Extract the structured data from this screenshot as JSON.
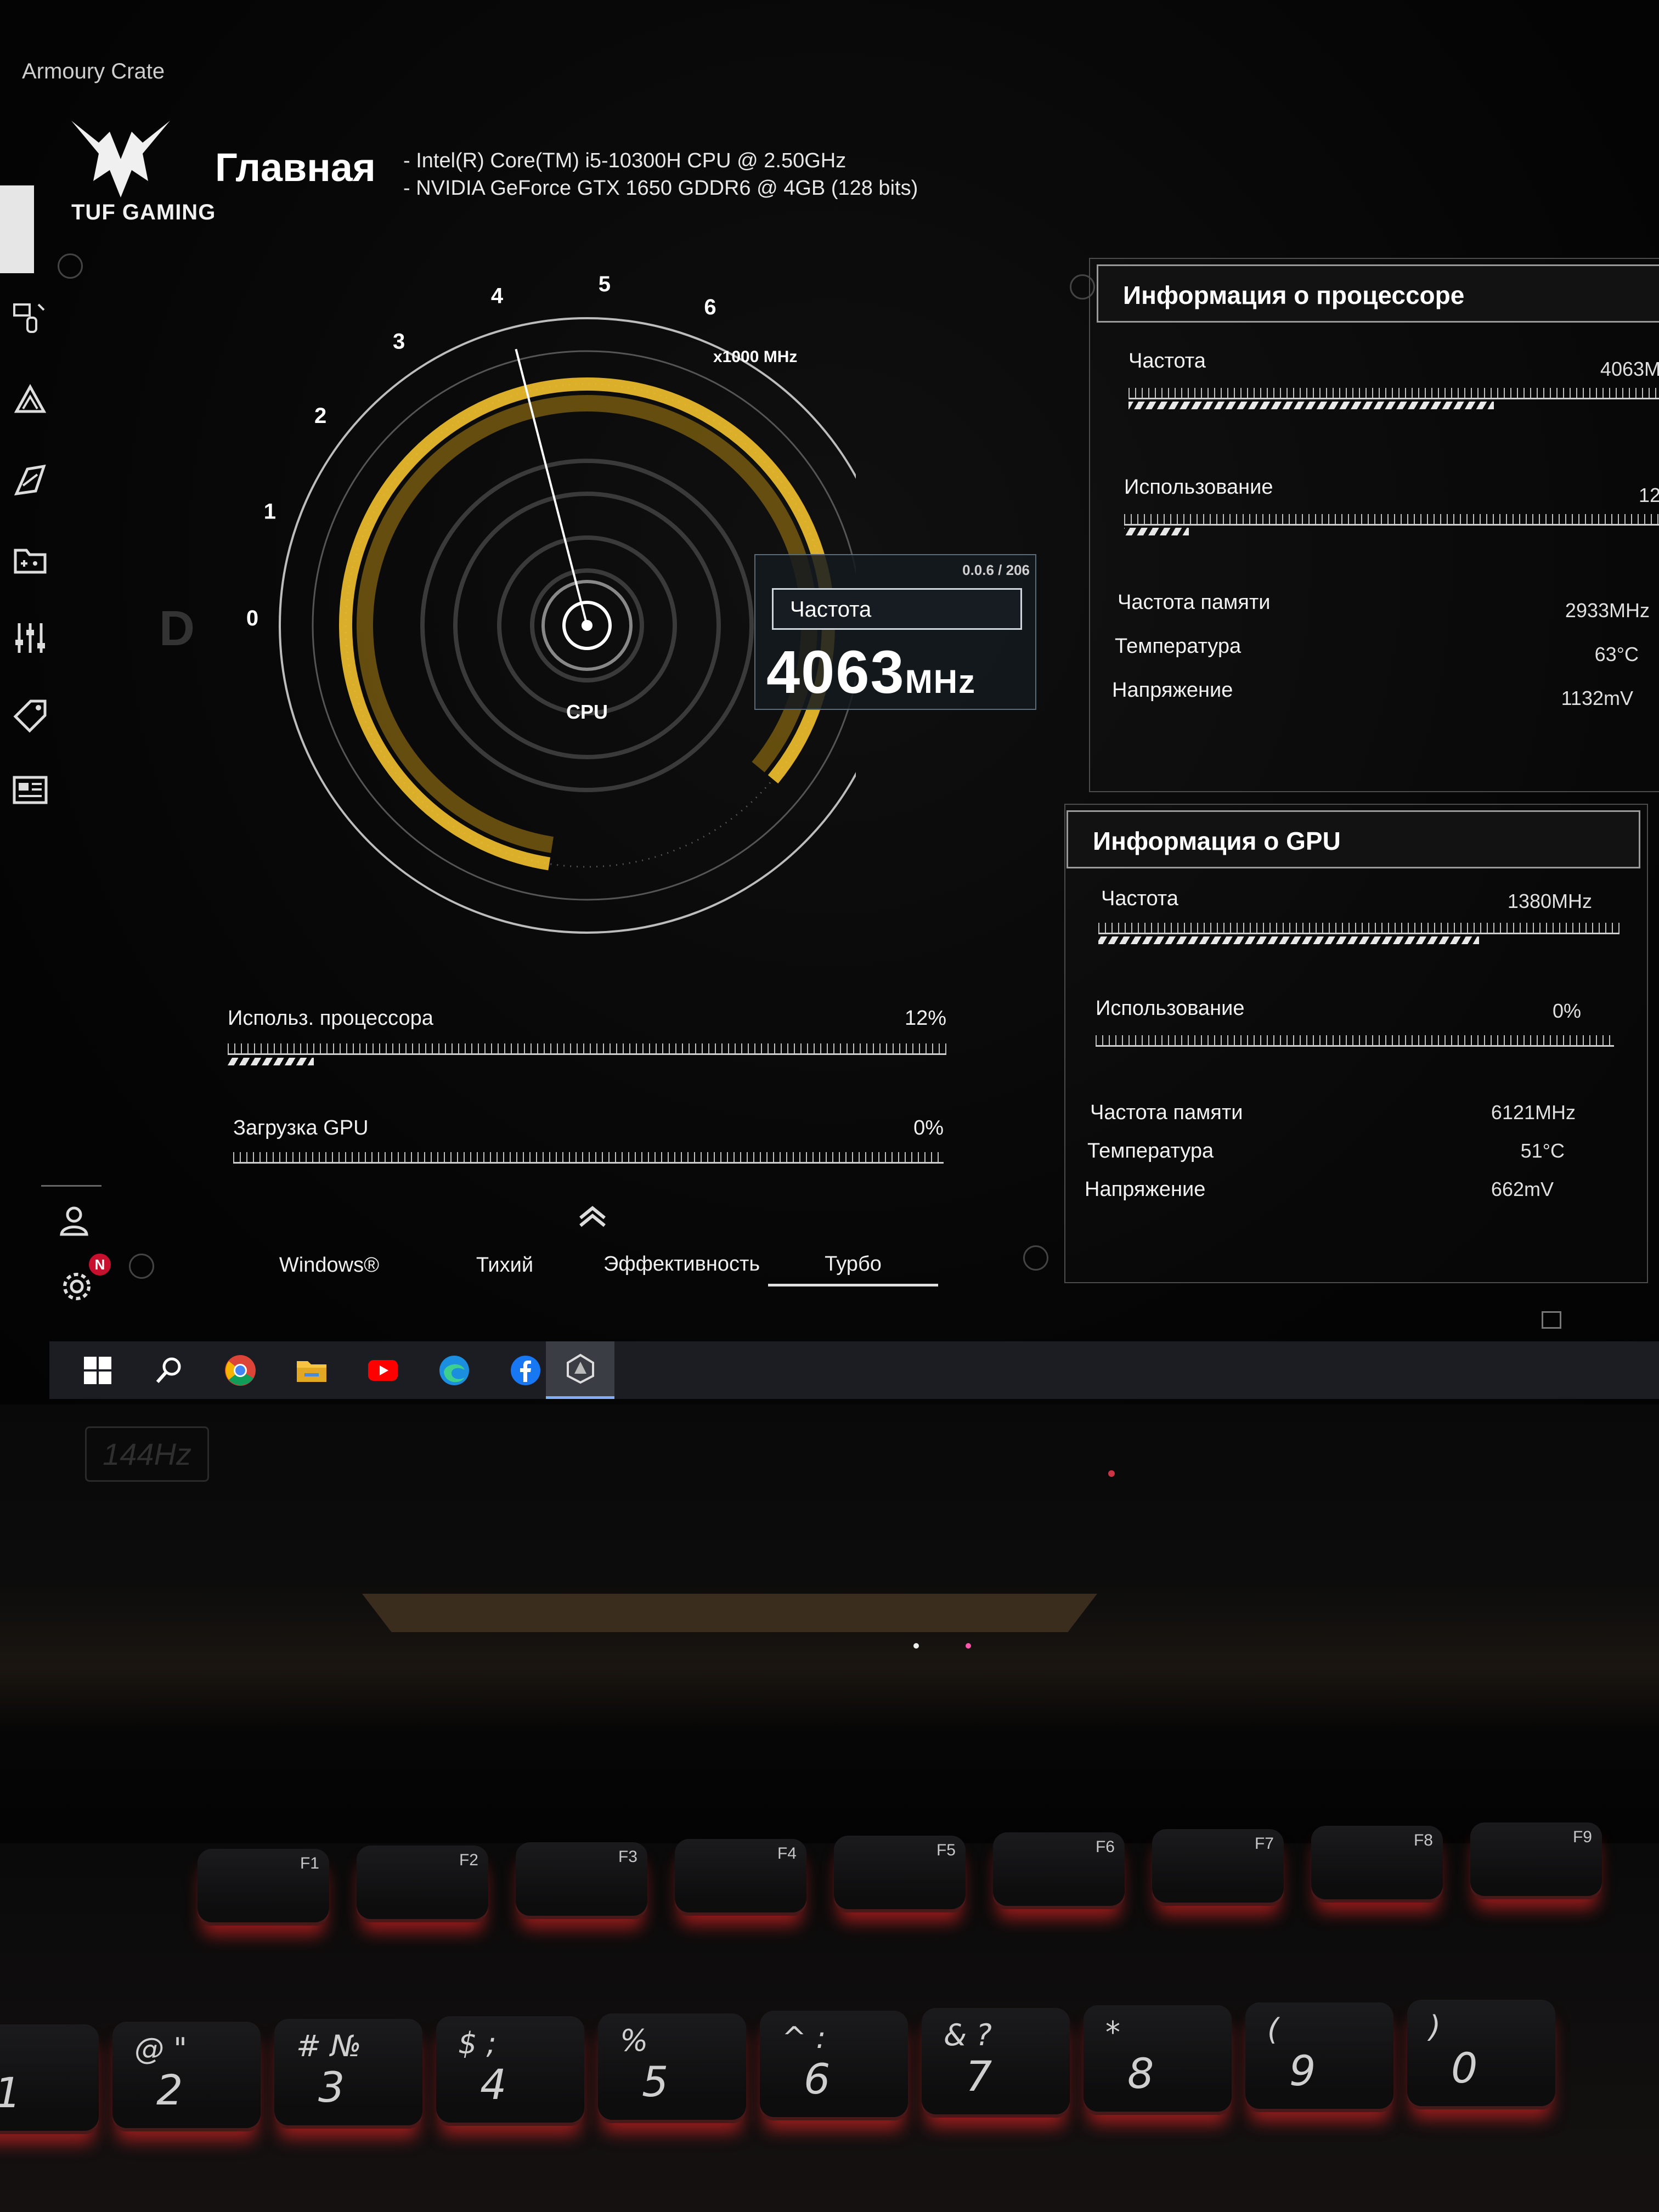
{
  "app": {
    "title": "Armoury Crate",
    "brand": "TUF GAMING",
    "page_title": "Главная",
    "hardware": [
      "-  Intel(R) Core(TM) i5-10300H CPU @ 2.50GHz",
      "-  NVIDIA GeForce GTX 1650 GDDR6 @ 4GB (128 bits)"
    ]
  },
  "sidebar": {
    "items": [
      {
        "icon": "keyboard-device-icon"
      },
      {
        "icon": "aura-lighting-icon"
      },
      {
        "icon": "armoury-scenario-icon"
      },
      {
        "icon": "game-library-icon"
      },
      {
        "icon": "equalizer-settings-icon"
      },
      {
        "icon": "deals-tag-icon"
      },
      {
        "icon": "news-icon"
      }
    ],
    "bottom": {
      "user_icon": "user-icon",
      "settings_icon": "settings-icon",
      "notification_badge": "N"
    }
  },
  "gauge": {
    "ticks": [
      "0",
      "1",
      "2",
      "3",
      "4",
      "5",
      "6"
    ],
    "unit": "x1000 MHz",
    "center_label": "CPU",
    "value_ghz": 4.063,
    "max_ghz": 6,
    "accent": "#f2c12e"
  },
  "freq_box": {
    "id": "0.0.6 / 206",
    "label": "Частота",
    "value": "4063",
    "unit": "MHz"
  },
  "usage": [
    {
      "label": "Использ. процессора",
      "value": "12%",
      "fraction": 0.12
    },
    {
      "label": "Загрузка GPU",
      "value": "0%",
      "fraction": 0.0
    }
  ],
  "modes": {
    "items": [
      "Windows®",
      "Тихий",
      "Эффективность",
      "Турбо"
    ],
    "active": "Турбо"
  },
  "cpu_panel": {
    "title": "Информация о процессоре",
    "freq_label": "Частота",
    "freq_value": "4063M",
    "freq_fraction": 0.68,
    "usage_label": "Использование",
    "usage_value": "12",
    "usage_fraction": 0.12,
    "rows": [
      {
        "label": "Частота памяти",
        "value": "2933MHz"
      },
      {
        "label": "Температура",
        "value": "63°C"
      },
      {
        "label": "Напряжение",
        "value": "1132mV"
      }
    ]
  },
  "gpu_panel": {
    "title": "Информация о GPU",
    "freq_label": "Частота",
    "freq_value": "1380MHz",
    "freq_fraction": 0.73,
    "usage_label": "Использование",
    "usage_value": "0%",
    "usage_fraction": 0.0,
    "rows": [
      {
        "label": "Частота памяти",
        "value": "6121MHz"
      },
      {
        "label": "Температура",
        "value": "51°C"
      },
      {
        "label": "Напряжение",
        "value": "662mV"
      }
    ]
  },
  "taskbar": {
    "items": [
      {
        "icon": "windows-start-icon"
      },
      {
        "icon": "search-icon"
      },
      {
        "icon": "chrome-icon"
      },
      {
        "icon": "file-explorer-icon"
      },
      {
        "icon": "youtube-icon"
      },
      {
        "icon": "edge-icon"
      },
      {
        "icon": "facebook-icon"
      },
      {
        "icon": "armoury-crate-icon",
        "active": true
      }
    ]
  },
  "bezel": {
    "refresh_label": "144Hz"
  },
  "keyboard": {
    "fn_row": [
      "F1",
      "F2",
      "F3",
      "F4",
      "F5",
      "F6",
      "F7",
      "F8",
      "F9"
    ],
    "num_row": [
      {
        "main": "1",
        "top": "!"
      },
      {
        "main": "2",
        "top": "@ \""
      },
      {
        "main": "3",
        "top": "# №"
      },
      {
        "main": "4",
        "top": "$ ;"
      },
      {
        "main": "5",
        "top": "%"
      },
      {
        "main": "6",
        "top": "^ :"
      },
      {
        "main": "7",
        "top": "& ?"
      },
      {
        "main": "8",
        "top": "*"
      },
      {
        "main": "9",
        "top": "("
      },
      {
        "main": "0",
        "top": ")"
      }
    ]
  }
}
